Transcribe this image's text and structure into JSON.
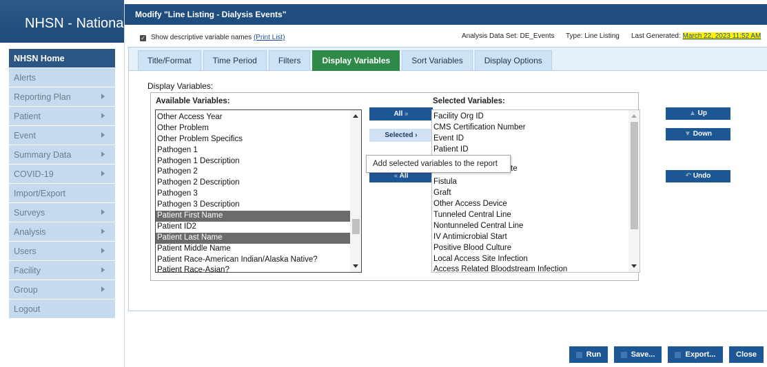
{
  "app": {
    "title": "NHSN - National He",
    "sidebar": [
      {
        "label": "NHSN Home",
        "arrow": false
      },
      {
        "label": "Alerts",
        "arrow": false
      },
      {
        "label": "Reporting Plan",
        "arrow": true
      },
      {
        "label": "Patient",
        "arrow": true
      },
      {
        "label": "Event",
        "arrow": true
      },
      {
        "label": "Summary Data",
        "arrow": true
      },
      {
        "label": "COVID-19",
        "arrow": true
      },
      {
        "label": "Import/Export",
        "arrow": false
      },
      {
        "label": "Surveys",
        "arrow": true
      },
      {
        "label": "Analysis",
        "arrow": true
      },
      {
        "label": "Users",
        "arrow": true
      },
      {
        "label": "Facility",
        "arrow": true
      },
      {
        "label": "Group",
        "arrow": true
      },
      {
        "label": "Logout",
        "arrow": false
      }
    ]
  },
  "modal": {
    "title": "Modify \"Line Listing - Dialysis Events\"",
    "show_descriptive_label": "Show descriptive variable names",
    "print_list_link": "(Print List)",
    "analysis_data_set_label": "Analysis Data Set: DE_Events",
    "type_label": "Type: Line Listing",
    "last_generated_label": "Last Generated:",
    "last_generated_value": "March 22, 2023 11:52 AM",
    "tabs": [
      "Title/Format",
      "Time Period",
      "Filters",
      "Display Variables",
      "Sort Variables",
      "Display Options"
    ],
    "active_tab": "Display Variables",
    "display_variables_label": "Display Variables:",
    "available_label": "Available Variables:",
    "selected_label": "Selected Variables:",
    "available_options": [
      {
        "text": "Other Access Year",
        "selected": false
      },
      {
        "text": "Other Problem",
        "selected": false
      },
      {
        "text": "Other Problem Specifics",
        "selected": false
      },
      {
        "text": "Pathogen 1",
        "selected": false
      },
      {
        "text": "Pathogen 1 Description",
        "selected": false
      },
      {
        "text": "Pathogen 2",
        "selected": false
      },
      {
        "text": "Pathogen 2 Description",
        "selected": false
      },
      {
        "text": "Pathogen 3",
        "selected": false
      },
      {
        "text": "Pathogen 3 Description",
        "selected": false
      },
      {
        "text": "Patient First Name",
        "selected": true
      },
      {
        "text": "Patient ID2",
        "selected": false
      },
      {
        "text": "Patient Last Name",
        "selected": true
      },
      {
        "text": "Patient Middle Name",
        "selected": false
      },
      {
        "text": "Patient Race-American Indian/Alaska Native?",
        "selected": false
      },
      {
        "text": "Patient Race-Asian?",
        "selected": false
      }
    ],
    "selected_options": [
      "Facility Org ID",
      "CMS Certification Number",
      "Event ID",
      "Patient ID",
      "",
      "",
      "Fistula",
      "Graft",
      "Other Access Device",
      "Tunneled Central Line",
      "Nontunneled Central Line",
      "IV Antimicrobial Start",
      "Positive Blood Culture",
      "Local Access Site Infection",
      "Access Related Bloodstream Infection"
    ],
    "buttons": {
      "add_all": "All",
      "add_selected": "Selected",
      "remove_all": "All",
      "up": "Up",
      "down": "Down",
      "undo": "Undo"
    },
    "tooltip": "Add selected variables to the report",
    "partial_hidden_text": "te",
    "footer": {
      "run": "Run",
      "save": "Save...",
      "export": "Export...",
      "close": "Close"
    }
  }
}
